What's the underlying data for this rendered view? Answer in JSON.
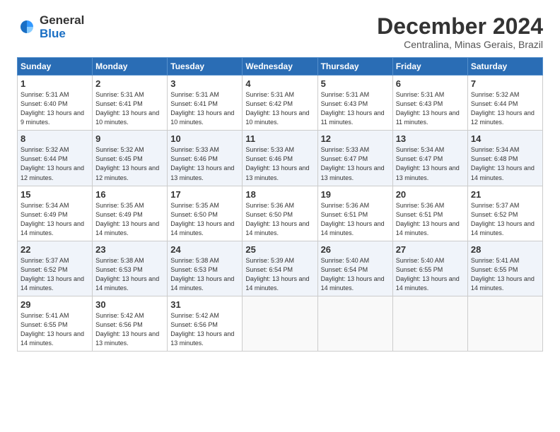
{
  "logo": {
    "general": "General",
    "blue": "Blue"
  },
  "title": "December 2024",
  "subtitle": "Centralina, Minas Gerais, Brazil",
  "headers": [
    "Sunday",
    "Monday",
    "Tuesday",
    "Wednesday",
    "Thursday",
    "Friday",
    "Saturday"
  ],
  "weeks": [
    [
      {
        "day": "1",
        "sunrise": "5:31 AM",
        "sunset": "6:40 PM",
        "daylight": "13 hours and 9 minutes."
      },
      {
        "day": "2",
        "sunrise": "5:31 AM",
        "sunset": "6:41 PM",
        "daylight": "13 hours and 10 minutes."
      },
      {
        "day": "3",
        "sunrise": "5:31 AM",
        "sunset": "6:41 PM",
        "daylight": "13 hours and 10 minutes."
      },
      {
        "day": "4",
        "sunrise": "5:31 AM",
        "sunset": "6:42 PM",
        "daylight": "13 hours and 10 minutes."
      },
      {
        "day": "5",
        "sunrise": "5:31 AM",
        "sunset": "6:43 PM",
        "daylight": "13 hours and 11 minutes."
      },
      {
        "day": "6",
        "sunrise": "5:31 AM",
        "sunset": "6:43 PM",
        "daylight": "13 hours and 11 minutes."
      },
      {
        "day": "7",
        "sunrise": "5:32 AM",
        "sunset": "6:44 PM",
        "daylight": "13 hours and 12 minutes."
      }
    ],
    [
      {
        "day": "8",
        "sunrise": "5:32 AM",
        "sunset": "6:44 PM",
        "daylight": "13 hours and 12 minutes."
      },
      {
        "day": "9",
        "sunrise": "5:32 AM",
        "sunset": "6:45 PM",
        "daylight": "13 hours and 12 minutes."
      },
      {
        "day": "10",
        "sunrise": "5:33 AM",
        "sunset": "6:46 PM",
        "daylight": "13 hours and 13 minutes."
      },
      {
        "day": "11",
        "sunrise": "5:33 AM",
        "sunset": "6:46 PM",
        "daylight": "13 hours and 13 minutes."
      },
      {
        "day": "12",
        "sunrise": "5:33 AM",
        "sunset": "6:47 PM",
        "daylight": "13 hours and 13 minutes."
      },
      {
        "day": "13",
        "sunrise": "5:34 AM",
        "sunset": "6:47 PM",
        "daylight": "13 hours and 13 minutes."
      },
      {
        "day": "14",
        "sunrise": "5:34 AM",
        "sunset": "6:48 PM",
        "daylight": "13 hours and 14 minutes."
      }
    ],
    [
      {
        "day": "15",
        "sunrise": "5:34 AM",
        "sunset": "6:49 PM",
        "daylight": "13 hours and 14 minutes."
      },
      {
        "day": "16",
        "sunrise": "5:35 AM",
        "sunset": "6:49 PM",
        "daylight": "13 hours and 14 minutes."
      },
      {
        "day": "17",
        "sunrise": "5:35 AM",
        "sunset": "6:50 PM",
        "daylight": "13 hours and 14 minutes."
      },
      {
        "day": "18",
        "sunrise": "5:36 AM",
        "sunset": "6:50 PM",
        "daylight": "13 hours and 14 minutes."
      },
      {
        "day": "19",
        "sunrise": "5:36 AM",
        "sunset": "6:51 PM",
        "daylight": "13 hours and 14 minutes."
      },
      {
        "day": "20",
        "sunrise": "5:36 AM",
        "sunset": "6:51 PM",
        "daylight": "13 hours and 14 minutes."
      },
      {
        "day": "21",
        "sunrise": "5:37 AM",
        "sunset": "6:52 PM",
        "daylight": "13 hours and 14 minutes."
      }
    ],
    [
      {
        "day": "22",
        "sunrise": "5:37 AM",
        "sunset": "6:52 PM",
        "daylight": "13 hours and 14 minutes."
      },
      {
        "day": "23",
        "sunrise": "5:38 AM",
        "sunset": "6:53 PM",
        "daylight": "13 hours and 14 minutes."
      },
      {
        "day": "24",
        "sunrise": "5:38 AM",
        "sunset": "6:53 PM",
        "daylight": "13 hours and 14 minutes."
      },
      {
        "day": "25",
        "sunrise": "5:39 AM",
        "sunset": "6:54 PM",
        "daylight": "13 hours and 14 minutes."
      },
      {
        "day": "26",
        "sunrise": "5:40 AM",
        "sunset": "6:54 PM",
        "daylight": "13 hours and 14 minutes."
      },
      {
        "day": "27",
        "sunrise": "5:40 AM",
        "sunset": "6:55 PM",
        "daylight": "13 hours and 14 minutes."
      },
      {
        "day": "28",
        "sunrise": "5:41 AM",
        "sunset": "6:55 PM",
        "daylight": "13 hours and 14 minutes."
      }
    ],
    [
      {
        "day": "29",
        "sunrise": "5:41 AM",
        "sunset": "6:55 PM",
        "daylight": "13 hours and 14 minutes."
      },
      {
        "day": "30",
        "sunrise": "5:42 AM",
        "sunset": "6:56 PM",
        "daylight": "13 hours and 13 minutes."
      },
      {
        "day": "31",
        "sunrise": "5:42 AM",
        "sunset": "6:56 PM",
        "daylight": "13 hours and 13 minutes."
      },
      null,
      null,
      null,
      null
    ]
  ]
}
